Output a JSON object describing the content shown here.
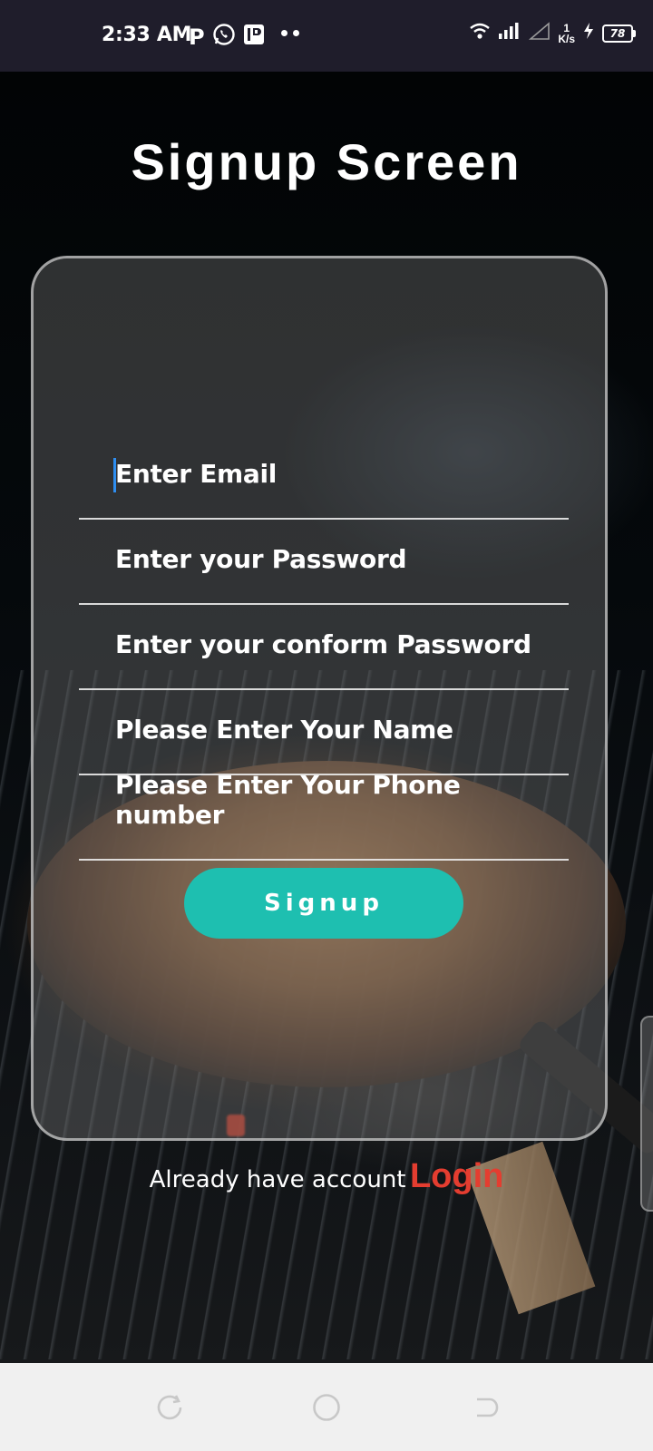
{
  "status_bar": {
    "time": "2:33 AM",
    "app_icon_p": "P",
    "network_speed_value": "1",
    "network_speed_unit": "K/s",
    "battery_level": "78",
    "icons": [
      "p-icon",
      "whatsapp-icon",
      "parking-app-icon",
      "more-dots-icon",
      "wifi-icon",
      "signal-icon",
      "signal-empty-icon",
      "charging-icon",
      "battery-icon"
    ]
  },
  "screen": {
    "title": "Signup Screen"
  },
  "form": {
    "fields": [
      {
        "name": "email",
        "placeholder": "Enter Email"
      },
      {
        "name": "password",
        "placeholder": "Enter your Password"
      },
      {
        "name": "confirm_password",
        "placeholder": "Enter your conform Password"
      },
      {
        "name": "name",
        "placeholder": "Please Enter Your Name"
      },
      {
        "name": "phone",
        "placeholder": "Please Enter Your Phone number"
      }
    ],
    "submit_label": "Signup"
  },
  "footer": {
    "prompt": "Already have account",
    "login_label": "Login"
  },
  "colors": {
    "accent_button": "#1ebfb0",
    "login_link": "#e43d30",
    "caret": "#2e8ef0",
    "status_bar_bg": "#1f1d2b"
  },
  "nav_bar": {
    "icons": [
      "recent-apps-icon",
      "home-icon",
      "back-icon"
    ]
  }
}
